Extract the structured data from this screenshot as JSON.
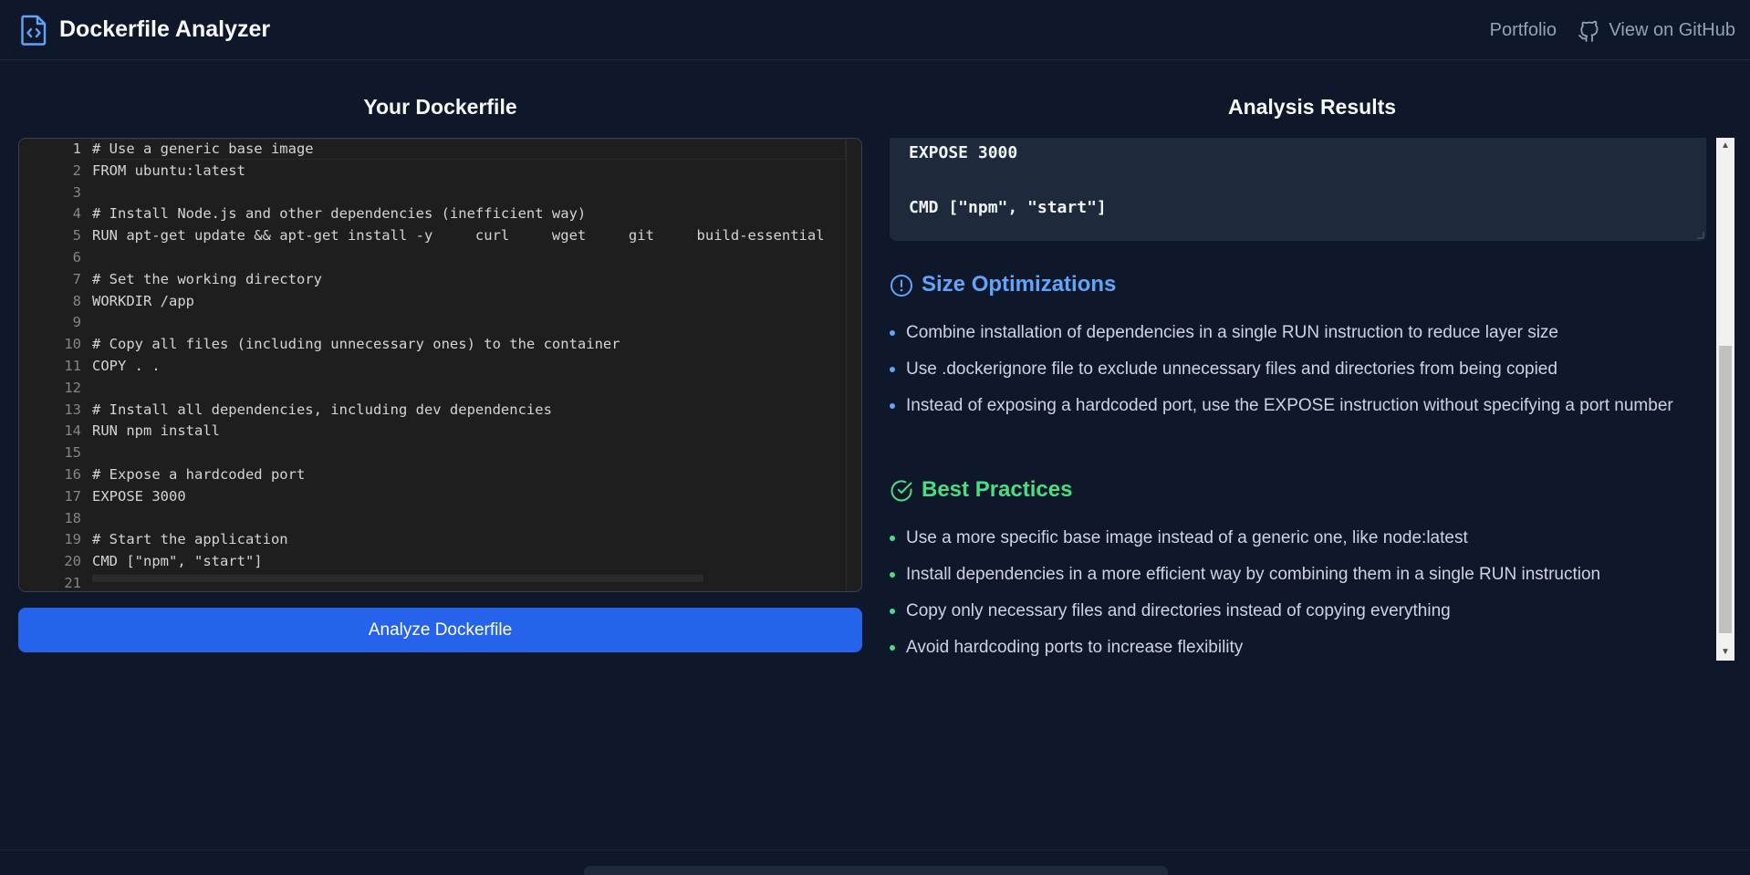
{
  "header": {
    "title": "Dockerfile Analyzer",
    "portfolio_label": "Portfolio",
    "github_label": "View on GitHub"
  },
  "editor": {
    "title": "Your Dockerfile",
    "line_numbers": [
      "1",
      "2",
      "3",
      "4",
      "5",
      "6",
      "7",
      "8",
      "9",
      "10",
      "11",
      "12",
      "13",
      "14",
      "15",
      "16",
      "17",
      "18",
      "19",
      "20",
      "21"
    ],
    "lines": [
      "# Use a generic base image",
      "FROM ubuntu:latest",
      "",
      "# Install Node.js and other dependencies (inefficient way)",
      "RUN apt-get update && apt-get install -y     curl     wget     git     build-essential",
      "",
      "# Set the working directory",
      "WORKDIR /app",
      "",
      "# Copy all files (including unnecessary ones) to the container",
      "COPY . .",
      "",
      "# Install all dependencies, including dev dependencies",
      "RUN npm install",
      "",
      "# Expose a hardcoded port",
      "EXPOSE 3000",
      "",
      "# Start the application",
      "CMD [\"npm\", \"start\"]",
      ""
    ],
    "analyze_button": "Analyze Dockerfile"
  },
  "results": {
    "title": "Analysis Results",
    "code_lines": [
      "EXPOSE 3000",
      "",
      "CMD [\"npm\", \"start\"]"
    ],
    "size_optimizations": {
      "title": "Size Optimizations",
      "items": [
        "Combine installation of dependencies in a single RUN instruction to reduce layer size",
        "Use .dockerignore file to exclude unnecessary files and directories from being copied",
        "Instead of exposing a hardcoded port, use the EXPOSE instruction without specifying a port number"
      ]
    },
    "best_practices": {
      "title": "Best Practices",
      "items": [
        "Use a more specific base image instead of a generic one, like node:latest",
        "Install dependencies in a more efficient way by combining them in a single RUN instruction",
        "Copy only necessary files and directories instead of copying everything",
        "Avoid hardcoding ports to increase flexibility"
      ]
    }
  },
  "colors": {
    "background": "#0f172a",
    "accent": "#2563eb",
    "size_section": "#60a5fa",
    "best_section": "#4ade80"
  },
  "icons": {
    "logo": "file-code-icon",
    "github": "github-icon",
    "size": "alert-circle-icon",
    "best": "check-circle-icon"
  }
}
